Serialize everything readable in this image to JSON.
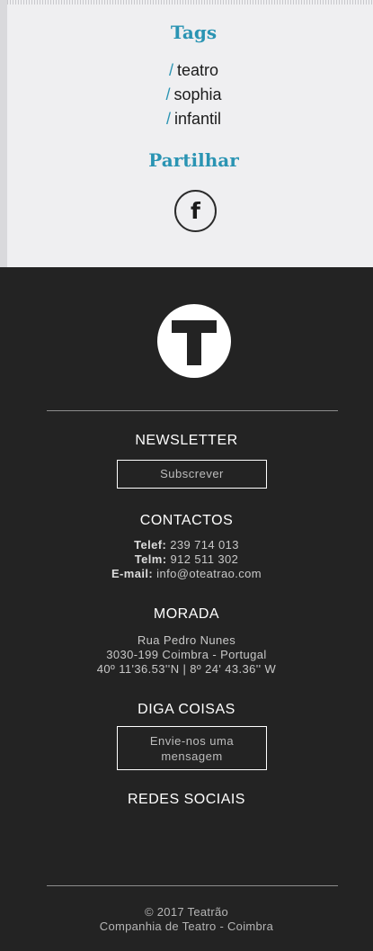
{
  "tags": {
    "title": "Tags",
    "items": [
      "teatro",
      "sophia",
      "infantil"
    ],
    "separator": "/"
  },
  "share": {
    "title": "Partilhar",
    "facebook_glyph": "f",
    "facebook_icon": "facebook-icon"
  },
  "footer": {
    "logo_icon": "teatrao-logo-icon",
    "newsletter": {
      "title": "NEWSLETTER",
      "button": "Subscrever"
    },
    "contacts": {
      "title": "CONTACTOS",
      "phone_label": "Telef:",
      "phone": "239 714 013",
      "mobile_label": "Telm:",
      "mobile": "912 511 302",
      "email_label": "E-mail:",
      "email": "info@oteatrao.com"
    },
    "address": {
      "title": "MORADA",
      "street": "Rua Pedro Nunes",
      "city": "3030-199 Coimbra - Portugal",
      "coords": "40º 11'36.53''N | 8º 24' 43.36'' W"
    },
    "contact_form": {
      "title": "DIGA COISAS",
      "button_line1": "Envie-nos uma",
      "button_line2": "mensagem"
    },
    "social": {
      "title": "REDES SOCIAIS"
    },
    "copyright": {
      "line1": "© 2017 Teatrão",
      "line2": "Companhia de Teatro - Coimbra"
    }
  },
  "colors": {
    "accent": "#2a94b3",
    "footer_bg": "#232323",
    "top_bg": "#efeff1"
  }
}
